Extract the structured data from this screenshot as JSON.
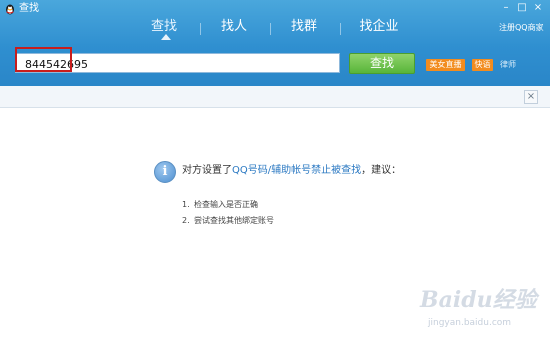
{
  "window": {
    "title": "查找",
    "icon": "qq-penguin-icon",
    "controls": [
      "minimize-icon",
      "maximize-icon",
      "close-icon"
    ]
  },
  "tabs": [
    {
      "label": "查找",
      "active": true
    },
    {
      "label": "找人",
      "active": false
    },
    {
      "label": "找群",
      "active": false
    },
    {
      "label": "找企业",
      "active": false
    }
  ],
  "header": {
    "register_link": "注册QQ商家"
  },
  "search": {
    "value": "844542695",
    "button_label": "查找"
  },
  "tags": [
    "美女直播",
    "快语",
    "律师"
  ],
  "message": {
    "prefix": "对方设置了",
    "link": "QQ号码/辅助帐号禁止被查找",
    "suffix": "，建议：",
    "icon": "info-icon"
  },
  "suggestions": [
    {
      "num": "1.",
      "text": "检查输入是否正确"
    },
    {
      "num": "2.",
      "text": "尝试查找其他绑定账号"
    }
  ],
  "watermark": {
    "text": "Baidu经验",
    "sub": "jingyan.baidu.com"
  },
  "colors": {
    "header_blue": "#2f8fd0",
    "search_green": "#58b53a",
    "highlight_red": "#c81d1d",
    "link_blue": "#2a78c2",
    "tag_orange": "#f28c1e"
  }
}
